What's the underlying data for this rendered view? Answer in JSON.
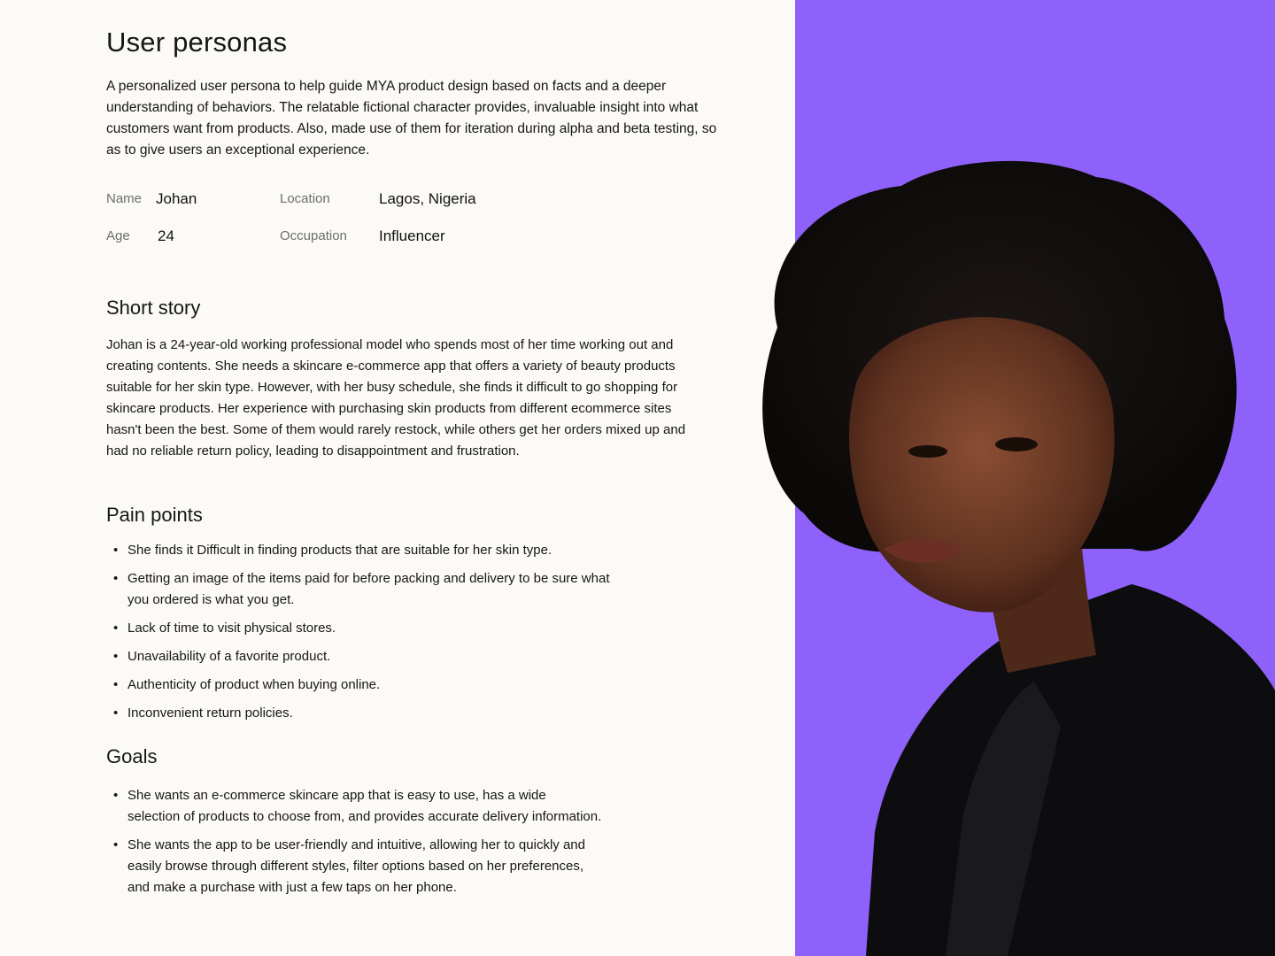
{
  "page": {
    "title": "User personas",
    "intro": "A personalized user persona to help guide MYA product design based on facts and a deeper understanding of behaviors. The relatable fictional character provides, invaluable insight into what customers want from products. Also, made use of them for iteration during alpha and beta testing, so as to give users an exceptional experience."
  },
  "persona": {
    "name_label": "Name",
    "name": "Johan",
    "age_label": "Age",
    "age": "24",
    "location_label": "Location",
    "location": "Lagos, Nigeria",
    "occupation_label": "Occupation",
    "occupation": "Influencer"
  },
  "short_story": {
    "heading": "Short story",
    "text": "Johan is a 24-year-old working professional model who spends most of her time working out and creating contents. She needs a skincare e-commerce app that offers a variety of beauty products suitable for her skin type. However, with her busy schedule, she finds it difficult to go shopping for skincare products. Her experience with purchasing skin products from different ecommerce sites hasn't been the best. Some of them would rarely restock, while others get her orders mixed up and had no reliable return policy, leading to disappointment and frustration."
  },
  "pain_points": {
    "heading": "Pain points",
    "items": [
      "She finds it Difficult in finding products that are suitable for her skin type.",
      "Getting an image of the items paid for before packing and delivery to be sure what you ordered is what you get.",
      "Lack of time to visit physical stores.",
      "Unavailability of a favorite product.",
      "Authenticity of product when buying online.",
      "Inconvenient return policies."
    ]
  },
  "goals": {
    "heading": "Goals",
    "items": [
      "She wants an e-commerce skincare app that is easy to use, has a wide selection of products to choose from, and provides accurate delivery information.",
      "She wants the app to be user-friendly and intuitive, allowing her to quickly and easily browse through different styles, filter options based on her preferences, and make a purchase with just a few taps on her phone."
    ]
  },
  "colors": {
    "background": "#fcfaf6",
    "accent_panel": "#8e61fa",
    "text": "#161616",
    "muted_label": "#6d6d6d"
  },
  "icons": {
    "bullet": "•"
  }
}
